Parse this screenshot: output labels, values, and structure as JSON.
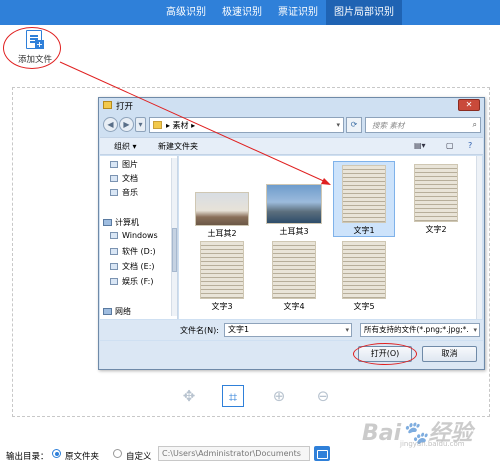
{
  "topbar": {
    "tabs": [
      {
        "label": "高级识别",
        "active": false
      },
      {
        "label": "极速识别",
        "active": false
      },
      {
        "label": "票证识别",
        "active": false
      },
      {
        "label": "图片局部识别",
        "active": true
      }
    ]
  },
  "add_file": {
    "label": "添加文件",
    "icon": "add-file-icon"
  },
  "dialog": {
    "title": "打开",
    "close_label": "✕",
    "address": {
      "path": "▸ 素材 ▸"
    },
    "search_placeholder": "搜索 素材",
    "toolbar": {
      "organize": "组织 ▾",
      "new_folder": "新建文件夹"
    },
    "nav": {
      "libraries": [
        {
          "label": "图片",
          "icon": "pictures-icon"
        },
        {
          "label": "文档",
          "icon": "documents-icon"
        },
        {
          "label": "音乐",
          "icon": "music-icon"
        }
      ],
      "computer": {
        "label": "计算机",
        "icon": "computer-icon"
      },
      "drives": [
        {
          "label": "Windows",
          "icon": "drive-icon"
        },
        {
          "label": "软件 (D:)",
          "icon": "drive-icon"
        },
        {
          "label": "文档 (E:)",
          "icon": "drive-icon"
        },
        {
          "label": "娱乐 (F:)",
          "icon": "drive-icon"
        }
      ],
      "network": {
        "label": "网络",
        "icon": "network-icon"
      }
    },
    "files": [
      {
        "name": "土耳其2",
        "kind": "photo"
      },
      {
        "name": "土耳其3",
        "kind": "photo"
      },
      {
        "name": "文字1",
        "kind": "document",
        "selected": true
      },
      {
        "name": "文字2",
        "kind": "document"
      },
      {
        "name": "文字3",
        "kind": "document"
      },
      {
        "name": "文字4",
        "kind": "document"
      },
      {
        "name": "文字5",
        "kind": "document"
      }
    ],
    "filename_label": "文件名(N):",
    "filename_value": "文字1",
    "filter_value": "所有支持的文件(*.png;*.jpg;*.",
    "open_button": "打开(O)",
    "cancel_button": "取消"
  },
  "bottom_tools": [
    {
      "name": "move-icon",
      "glyph": "✥"
    },
    {
      "name": "crop-icon",
      "glyph": "⌗"
    },
    {
      "name": "zoom-in-icon",
      "glyph": "⊕"
    },
    {
      "name": "zoom-out-icon",
      "glyph": "⊖"
    }
  ],
  "output": {
    "label": "输出目录：",
    "option_source": "原文件夹",
    "option_custom": "自定义",
    "path": "C:\\Users\\Administrator\\Documents"
  },
  "watermark": {
    "main": "Bai🐾经验",
    "sub": "jingyan.baidu.com"
  },
  "colors": {
    "accent": "#2f80d9",
    "annotation": "#e02020"
  }
}
